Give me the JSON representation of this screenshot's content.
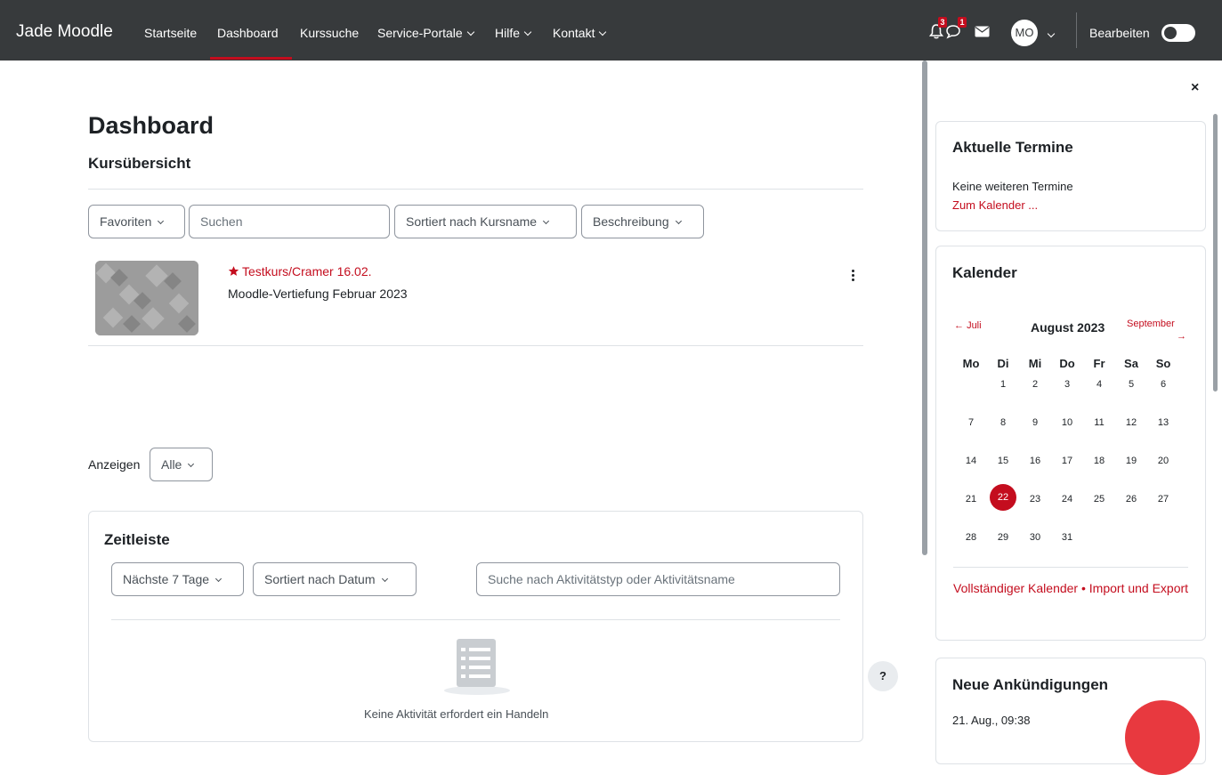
{
  "navbar": {
    "brand": "Jade Moodle",
    "items": [
      {
        "label": "Startseite"
      },
      {
        "label": "Dashboard"
      },
      {
        "label": "Kurssuche"
      },
      {
        "label": "Service-Portale"
      },
      {
        "label": "Hilfe"
      },
      {
        "label": "Kontakt"
      }
    ],
    "notifications_count": "3",
    "messages_count": "1",
    "avatar_initials": "MO",
    "edit_mode_label": "Bearbeiten"
  },
  "main": {
    "page_title": "Dashboard",
    "course_overview": {
      "title": "Kursübersicht",
      "filter_label": "Favoriten",
      "search_placeholder": "Suchen",
      "sort_label": "Sortiert nach Kursname",
      "view_label": "Beschreibung",
      "course": {
        "name": "Testkurs/Cramer 16.02.",
        "subtitle": "Moodle-Vertiefung Februar 2023"
      },
      "show_label": "Anzeigen",
      "show_value": "Alle"
    },
    "timeline": {
      "title": "Zeitleiste",
      "range_label": "Nächste 7 Tage",
      "sort_label": "Sortiert nach Datum",
      "search_placeholder": "Suche nach Aktivitätstyp oder Aktivitätsname",
      "empty_text": "Keine Aktivität erfordert ein Handeln"
    },
    "help_label": "?"
  },
  "drawer": {
    "close_label": "×",
    "upcoming": {
      "title": "Aktuelle Termine",
      "text": "Keine weiteren Termine",
      "link": "Zum Kalender ..."
    },
    "calendar": {
      "title": "Kalender",
      "prev": "Juli",
      "month": "August 2023",
      "next": "September",
      "weekdays": [
        "Mo",
        "Di",
        "Mi",
        "Do",
        "Fr",
        "Sa",
        "So"
      ],
      "today": "22",
      "footer": "Vollständiger Kalender • Import und Export"
    },
    "announcements": {
      "title": "Neue Ankündigungen",
      "first_date": "21. Aug., 09:38"
    }
  }
}
